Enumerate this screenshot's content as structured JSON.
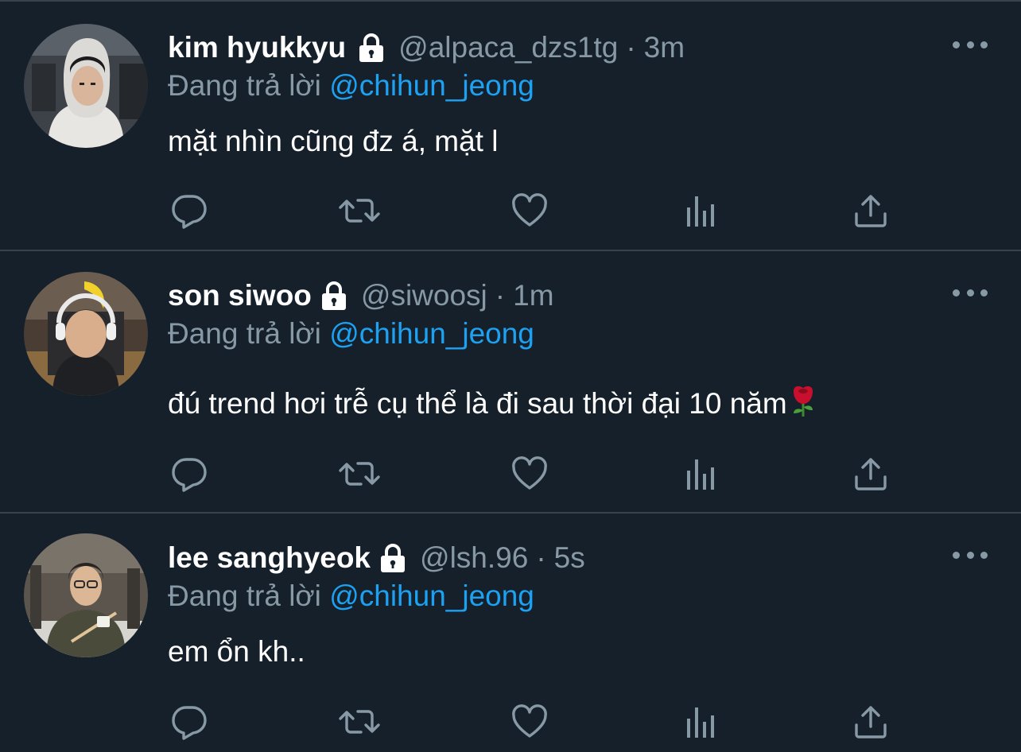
{
  "colors": {
    "background": "#15202b",
    "divider": "#38444d",
    "muted": "#8899a6",
    "mention": "#1da1f2",
    "text": "#ffffff"
  },
  "tweets": [
    {
      "display_name": "kim hyukkyu",
      "handle": "@alpaca_dzs1tg",
      "separator": "·",
      "time": "3m",
      "reply_prefix": "Đang trả lời",
      "reply_to": "@chihun_jeong",
      "text": "mặt nhìn cũng đz á, mặt l",
      "protected_icon": "lock-icon"
    },
    {
      "display_name": "son siwoo",
      "handle": "@siwoosj",
      "separator": "·",
      "time": "1m",
      "reply_prefix": "Đang trả lời",
      "reply_to": "@chihun_jeong",
      "text": "đú trend hơi trễ cụ thể là đi sau thời đại 10 năm",
      "text_emoji": "rose-emoji",
      "protected_icon": "lock-icon"
    },
    {
      "display_name": "lee sanghyeok",
      "handle": "@lsh.96",
      "separator": "·",
      "time": "5s",
      "reply_prefix": "Đang trả lời",
      "reply_to": "@chihun_jeong",
      "text": "em ổn kh..",
      "protected_icon": "lock-icon"
    }
  ],
  "actions": [
    "reply-icon",
    "retweet-icon",
    "like-icon",
    "analytics-icon",
    "share-icon"
  ]
}
